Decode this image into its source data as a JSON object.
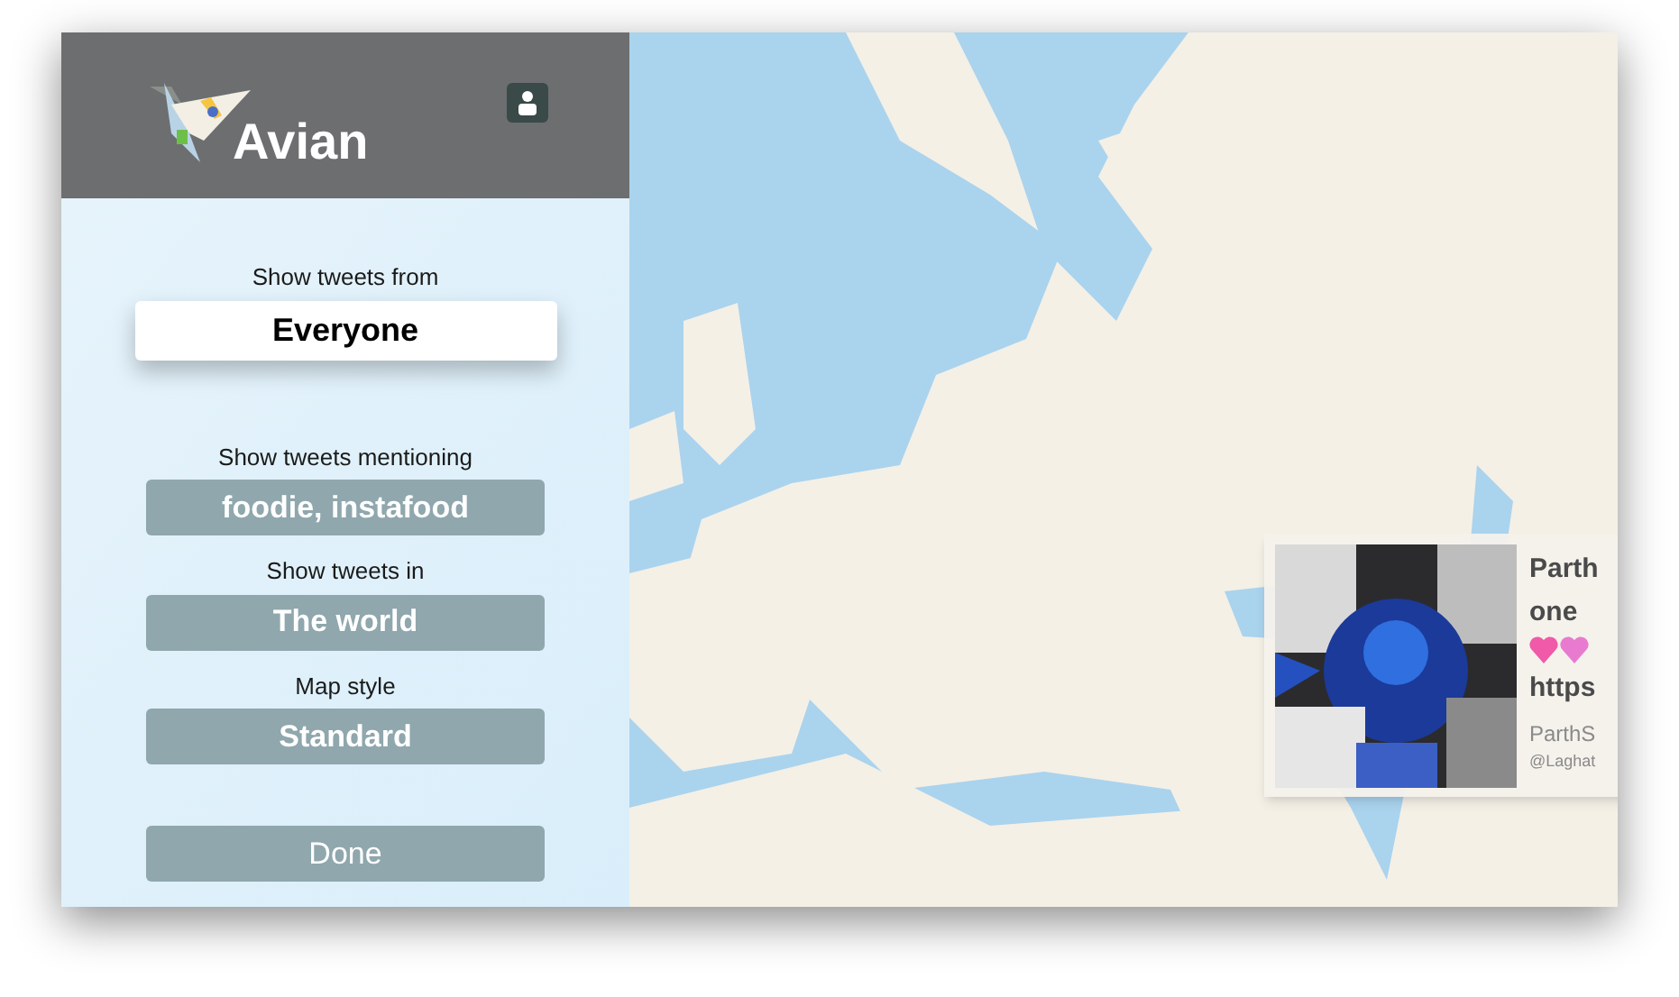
{
  "app": {
    "title": "Avian"
  },
  "filters": [
    {
      "label": "Show tweets from",
      "value": "Everyone",
      "selected": true
    },
    {
      "label": "Show tweets mentioning",
      "value": "foodie, instafood",
      "selected": false
    },
    {
      "label": "Show tweets in",
      "value": "The world",
      "selected": false
    },
    {
      "label": "Map style",
      "value": "Standard",
      "selected": false
    }
  ],
  "done_button": {
    "label": "Done",
    "selected": false
  },
  "tweet_card": {
    "name_line": "Parth",
    "text_lines": [
      "one",
      "https"
    ],
    "author": "ParthS",
    "handle": "@Laghat"
  }
}
